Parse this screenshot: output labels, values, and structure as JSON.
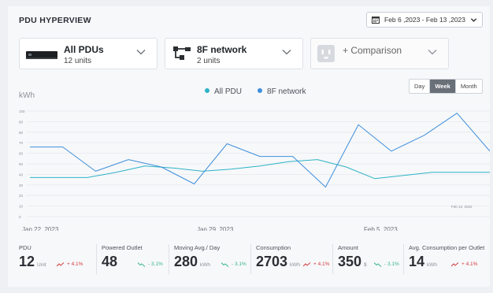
{
  "header": {
    "title": "PDU HYPERVIEW",
    "date_range": "Feb 6 ,2023 - Feb 13 ,2023"
  },
  "selectors": [
    {
      "name": "All PDUs",
      "sub": "12 units",
      "icon": "pdu-device-icon"
    },
    {
      "name": "8F network",
      "sub": "2 units",
      "icon": "network-topology-icon"
    }
  ],
  "comparison": {
    "label": "+ Comparison",
    "icon": "outlet-icon"
  },
  "range_toggle": {
    "options": [
      "Day",
      "Week",
      "Month"
    ],
    "selected": "Week"
  },
  "colors": {
    "all_pdu": "#2cb3c6",
    "network": "#3f8fdc",
    "grid": "#e6e9ed",
    "up": "#d23a3a",
    "down": "#33b58a"
  },
  "chart_data": {
    "type": "line",
    "ylabel": "kWh",
    "ylim": [
      0,
      100
    ],
    "yticks": [
      "0",
      "10",
      "20",
      "30",
      "40",
      "50",
      "60",
      "70",
      "80",
      "90",
      "100"
    ],
    "xtick_labels": [
      "Jan 22 ,2023",
      "Jan 29, 2023",
      "Feb 5, 2023"
    ],
    "end_label": "Feb 12, 2022",
    "series": [
      {
        "name": "All PDU",
        "color": "#2cb3c6",
        "values": [
          37,
          37,
          37,
          42,
          48,
          46,
          43,
          45,
          48,
          52,
          54,
          47,
          36,
          39,
          42,
          42,
          42
        ]
      },
      {
        "name": "8F network",
        "color": "#3f8fdc",
        "values": [
          66,
          66,
          43,
          54,
          47,
          31,
          69,
          57,
          57,
          28,
          87,
          62,
          77,
          98,
          62
        ]
      }
    ]
  },
  "stats": [
    {
      "label": "PDU",
      "value": "12",
      "unit": "Unit",
      "trend": "+ 4.1%",
      "direction": "up"
    },
    {
      "label": "Powered Outlet",
      "value": "48",
      "unit": "",
      "trend": "- 3.1%",
      "direction": "down"
    },
    {
      "label": "Moving Avg./ Day",
      "value": "280",
      "unit": "kWh",
      "trend": "- 3.1%",
      "direction": "down"
    },
    {
      "label": "Consumption",
      "value": "2703",
      "unit": "kWh",
      "trend": "+ 4.1%",
      "direction": "up"
    },
    {
      "label": "Amount",
      "value": "350",
      "unit": "$",
      "trend": "- 3.1%",
      "direction": "down"
    },
    {
      "label": "Avg. Consumption per Outlet",
      "value": "14",
      "unit": "kWh",
      "trend": "+ 4.1%",
      "direction": "up"
    }
  ]
}
